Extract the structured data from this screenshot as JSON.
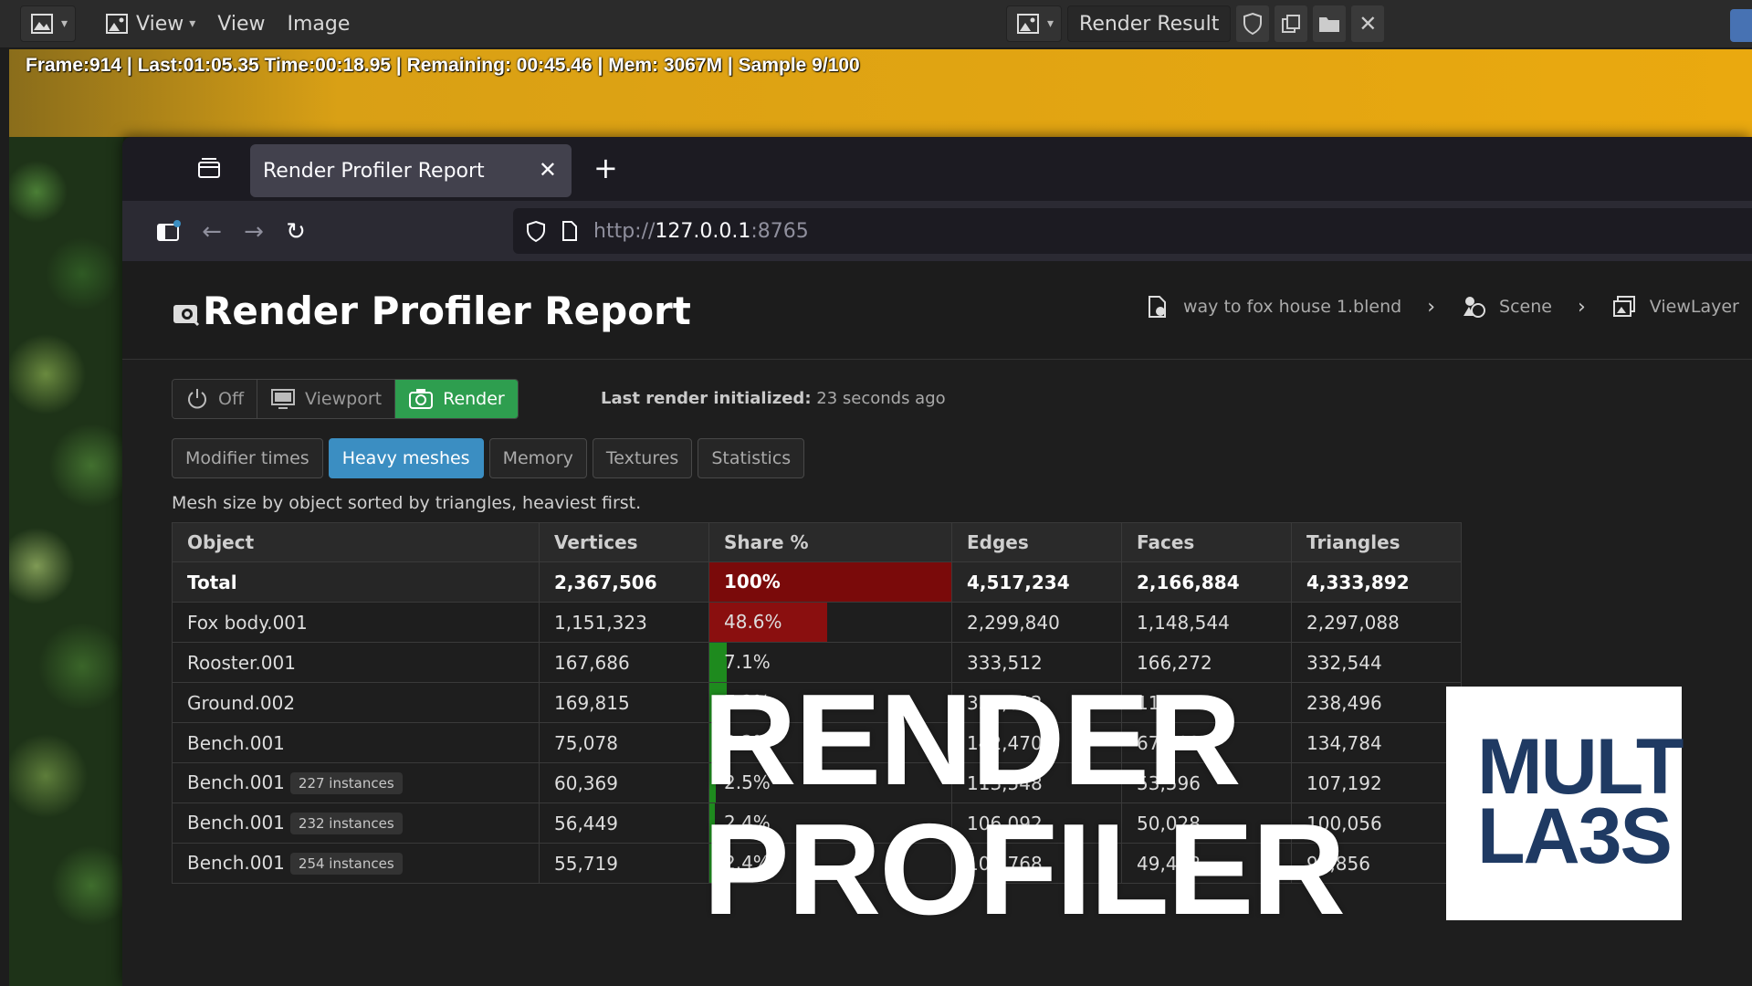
{
  "blender": {
    "menu": {
      "view1": "View",
      "view2": "View",
      "image": "Image"
    },
    "render_slot": "Render Result",
    "stats_line": "Frame:914 | Last:01:05.35 Time:00:18.95 | Remaining: 00:45.46 | Mem: 3067M | Sample 9/100"
  },
  "browser": {
    "tab_title": "Render Profiler Report",
    "url_scheme": "http://",
    "url_host": "127.0.0.1",
    "url_port": ":8765"
  },
  "page": {
    "title": "Render Profiler Report",
    "breadcrumb": [
      "way to fox house 1.blend",
      "Scene",
      "ViewLayer"
    ],
    "modes": [
      "Off",
      "Viewport",
      "Render"
    ],
    "active_mode": "Render",
    "last_render_label": "Last render initialized:",
    "last_render_value": "23 seconds ago",
    "tabs": [
      "Modifier times",
      "Heavy meshes",
      "Memory",
      "Textures",
      "Statistics"
    ],
    "active_tab": "Heavy meshes",
    "description": "Mesh size by object sorted by triangles, heaviest first.",
    "table": {
      "headers": [
        "Object",
        "Vertices",
        "Share %",
        "Edges",
        "Faces",
        "Triangles"
      ],
      "total": {
        "object": "Total",
        "vertices": "2,367,506",
        "share": "100%",
        "share_value": 100,
        "edges": "4,517,234",
        "faces": "2,166,884",
        "triangles": "4,333,892"
      },
      "rows": [
        {
          "object": "Fox body.001",
          "instances": "",
          "vertices": "1,151,323",
          "share": "48.6%",
          "share_value": 48.6,
          "edges": "2,299,840",
          "faces": "1,148,544",
          "triangles": "2,297,088"
        },
        {
          "object": "Rooster.001",
          "instances": "",
          "vertices": "167,686",
          "share": "7.1%",
          "share_value": 7.1,
          "edges": "333,512",
          "faces": "166,272",
          "triangles": "332,544"
        },
        {
          "object": "Ground.002",
          "instances": "",
          "vertices": "169,815",
          "share": "7.2%",
          "share_value": 7.2,
          "edges": "334,612",
          "faces": "119,248",
          "triangles": "238,496"
        },
        {
          "object": "Bench.001",
          "instances": "",
          "vertices": "75,078",
          "share": "3.2%",
          "share_value": 3.2,
          "edges": "142,470",
          "faces": "67,392",
          "triangles": "134,784"
        },
        {
          "object": "Bench.001",
          "instances": "227 instances",
          "vertices": "60,369",
          "share": "2.5%",
          "share_value": 2.5,
          "edges": "113,548",
          "faces": "53,596",
          "triangles": "107,192"
        },
        {
          "object": "Bench.001",
          "instances": "232 instances",
          "vertices": "56,449",
          "share": "2.4%",
          "share_value": 2.4,
          "edges": "106,092",
          "faces": "50,028",
          "triangles": "100,056"
        },
        {
          "object": "Bench.001",
          "instances": "254 instances",
          "vertices": "55,719",
          "share": "2.4%",
          "share_value": 2.4,
          "edges": "104,768",
          "faces": "49,428",
          "triangles": "98,856"
        }
      ]
    }
  },
  "overlay": {
    "title_line1": "RENDER",
    "title_line2": "PROFILER",
    "logo_line1": "MULT",
    "logo_line2": "LA3S"
  },
  "colors": {
    "total_bar": "#7a0a0a",
    "row_bar_heavy": "#8a0f0f",
    "row_bar_light": "#1e8a1e",
    "render_active": "#2e9e4f",
    "tab_active": "#3b8ec2",
    "logo_text": "#1f3a63"
  },
  "icons": [
    "image-editor-icon",
    "image-icon",
    "shield-icon",
    "duplicate-icon",
    "folder-icon",
    "close-icon",
    "tab-list-icon",
    "back-icon",
    "forward-icon",
    "reload-icon",
    "page-icon",
    "profiler-icon",
    "blend-file-icon",
    "scene-icon",
    "view-layer-icon",
    "power-icon",
    "monitor-icon",
    "camera-icon"
  ]
}
